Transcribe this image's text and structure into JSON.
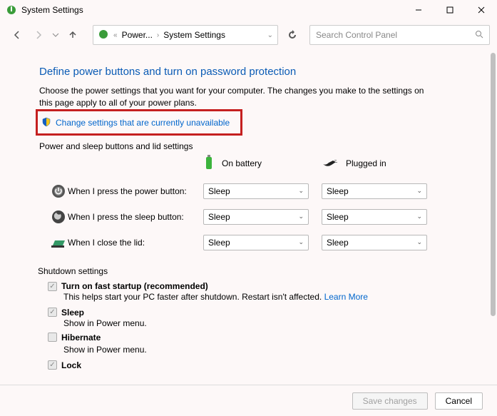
{
  "window": {
    "title": "System Settings"
  },
  "breadcrumb": {
    "loc1": "Power...",
    "loc2": "System Settings"
  },
  "search": {
    "placeholder": "Search Control Panel"
  },
  "page": {
    "heading": "Define power buttons and turn on password protection",
    "desc": "Choose the power settings that you want for your computer. The changes you make to the settings on this page apply to all of your power plans.",
    "change_link": "Change settings that are currently unavailable",
    "section1": "Power and sleep buttons and lid settings",
    "col_battery": "On battery",
    "col_plugged": "Plugged in",
    "rows": [
      {
        "label": "When I press the power button:",
        "battery": "Sleep",
        "plugged": "Sleep"
      },
      {
        "label": "When I press the sleep button:",
        "battery": "Sleep",
        "plugged": "Sleep"
      },
      {
        "label": "When I close the lid:",
        "battery": "Sleep",
        "plugged": "Sleep"
      }
    ],
    "section2": "Shutdown settings",
    "fast_title": "Turn on fast startup (recommended)",
    "fast_desc": "This helps start your PC faster after shutdown. Restart isn't affected. ",
    "learn_more": "Learn More",
    "sleep_title": "Sleep",
    "sleep_desc": "Show in Power menu.",
    "hibernate_title": "Hibernate",
    "hibernate_desc": "Show in Power menu.",
    "lock_title": "Lock"
  },
  "footer": {
    "save": "Save changes",
    "cancel": "Cancel"
  }
}
